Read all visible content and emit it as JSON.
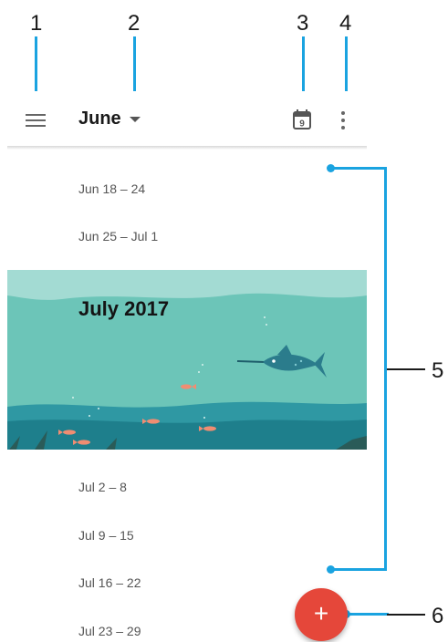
{
  "callouts": [
    "1",
    "2",
    "3",
    "4",
    "5",
    "6"
  ],
  "appbar": {
    "menu_icon": "hamburger-menu-icon",
    "month": "June",
    "today_day": "9",
    "today_icon": "calendar-today-icon",
    "overflow_icon": "more-vert-icon"
  },
  "weeks_before": [
    "Jun 18 – 24",
    "Jun 25 – Jul 1"
  ],
  "month_banner": {
    "title": "July 2017"
  },
  "weeks_after": [
    "Jul 2 – 8",
    "Jul 9 – 15",
    "Jul 16 – 22",
    "Jul 23 – 29"
  ],
  "fab": {
    "label": "+",
    "icon": "add-event-icon"
  },
  "colors": {
    "callout": "#1aa3e0",
    "fab": "#e5473a",
    "sea_light": "#64c2b6",
    "sea_dark": "#1e7f8c"
  }
}
